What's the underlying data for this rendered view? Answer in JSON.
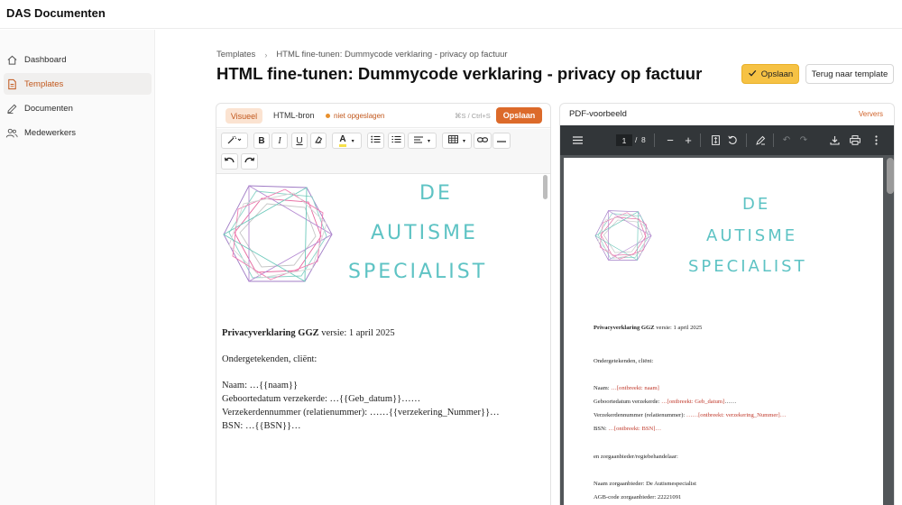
{
  "app": {
    "title": "DAS Documenten"
  },
  "sidebar": {
    "items": [
      {
        "label": "Dashboard",
        "icon": "home-icon",
        "active": false
      },
      {
        "label": "Templates",
        "icon": "file-icon",
        "active": true
      },
      {
        "label": "Documenten",
        "icon": "edit-icon",
        "active": false
      },
      {
        "label": "Medewerkers",
        "icon": "users-icon",
        "active": false
      }
    ]
  },
  "breadcrumb": {
    "root": "Templates",
    "current": "HTML fine-tunen: Dummycode verklaring - privacy op factuur"
  },
  "page": {
    "title": "HTML fine-tunen: Dummycode verklaring - privacy op factuur"
  },
  "header_actions": {
    "save_label": "Opslaan",
    "back_label": "Terug naar template"
  },
  "editor": {
    "tab_visual": "Visueel",
    "tab_html": "HTML-bron",
    "status": "niet opgeslagen",
    "shortcut": "⌘S / Ctrl+S",
    "save_label": "Opslaan",
    "logo": {
      "line1": "DE",
      "line2": "AUTISME",
      "line3": "SPECIALIST"
    },
    "content": {
      "heading_bold": "Privacyverklaring GGZ",
      "heading_rest": " versie: 1 april 2025",
      "signed": "Ondergetekenden, cliënt:",
      "name": "Naam: …{{naam}}",
      "dob": "Geboortedatum verzekerde: …{{Geb_datum}}……",
      "insured": "Verzekerdennummer (relatienummer): ……{{verzekering_Nummer}}…",
      "bsn": "BSN: …{{BSN}}…"
    }
  },
  "preview": {
    "title": "PDF-voorbeeld",
    "refresh": "Ververs",
    "page_current": "1",
    "page_total": "8",
    "logo": {
      "line1": "DE",
      "line2": "AUTISME",
      "line3": "SPECIALIST"
    },
    "content": {
      "heading_bold": "Privacyverklaring GGZ",
      "heading_rest": " versie: 1 april 2025",
      "signed": "Ondergetekenden, cliënt:",
      "name_label": "Naam: ",
      "name_value": "…[ontbreekt: naam]",
      "dob_label": "Geboortedatum verzekerde: ",
      "dob_value": "…[ontbreekt: Geb_datum]",
      "dob_suffix": "……",
      "insured_label": "Verzekerdennummer (relatienummer): ",
      "insured_value": "……[ontbreekt: verzekering_Nummer]…",
      "bsn_label": "BSN: ",
      "bsn_value": "…[ontbreekt: BSN]…",
      "provider_intro": "en zorgaanbieder/regiebehandelaar:",
      "provider_name": "Naam zorgaanbieder: De Autismespecialist",
      "agb": "AGB-code zorgaanbieder: 22221091"
    }
  },
  "colors": {
    "accent": "#dc6a2a",
    "highlight": "#f6c244",
    "logo_teal": "#5ec3c4",
    "missing_red": "#c0392b"
  }
}
